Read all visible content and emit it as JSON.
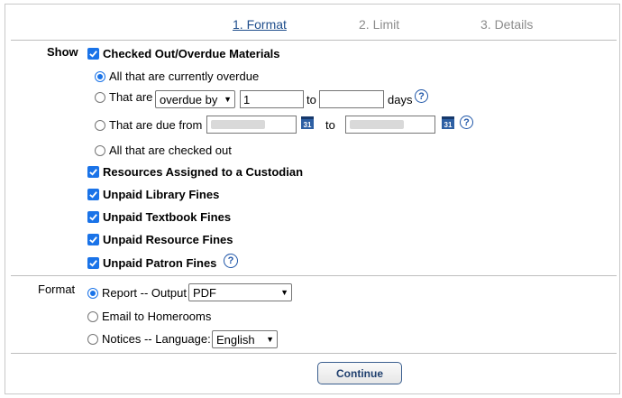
{
  "steps": {
    "format": "1. Format",
    "limit": "2. Limit",
    "details": "3. Details"
  },
  "show": {
    "label": "Show",
    "checked_out": "Checked Out/Overdue Materials",
    "opt_currently_overdue": "All that are currently overdue",
    "opt_that_are": "That are",
    "overdue_select": "overdue by",
    "overdue_value": "1",
    "to": "to",
    "days": "days",
    "opt_due_from": "That are due from",
    "cal_glyph": "31",
    "opt_all_checked_out": "All that are checked out",
    "custodian": "Resources Assigned to a Custodian",
    "library_fines": "Unpaid Library Fines",
    "textbook_fines": "Unpaid Textbook Fines",
    "resource_fines": "Unpaid Resource Fines",
    "patron_fines": "Unpaid Patron Fines"
  },
  "format": {
    "label": "Format",
    "report": "Report -- Output",
    "output_select": "PDF",
    "email": "Email to Homerooms",
    "notices": "Notices -- Language:",
    "language_select": "English"
  },
  "help_glyph": "?",
  "continue_label": "Continue"
}
